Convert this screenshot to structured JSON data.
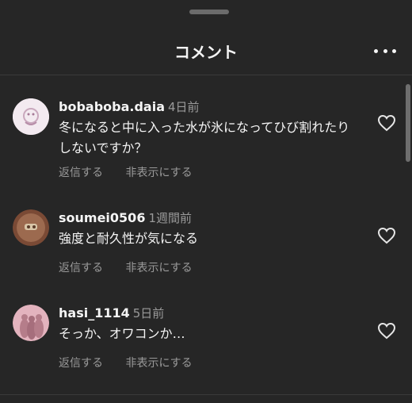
{
  "header": {
    "title": "コメント",
    "more_icon": "more-horizontal-icon"
  },
  "comments": [
    {
      "username": "bobaboba.daia",
      "time": "4日前",
      "text": "冬になると中に入った水が氷になってひび割れたりしないですか？",
      "reply_label": "返信する",
      "hide_label": "非表示にする"
    },
    {
      "username": "soumei0506",
      "time": "1週間前",
      "text": "強度と耐久性が気になる",
      "reply_label": "返信する",
      "hide_label": "非表示にする"
    },
    {
      "username": "hasi_1114",
      "time": "5日前",
      "text": "そっか、オワコンか…",
      "reply_label": "返信する",
      "hide_label": "非表示にする"
    }
  ],
  "colors": {
    "background": "#262626",
    "text": "#f5f5f5",
    "secondary": "#9a9a9a"
  }
}
